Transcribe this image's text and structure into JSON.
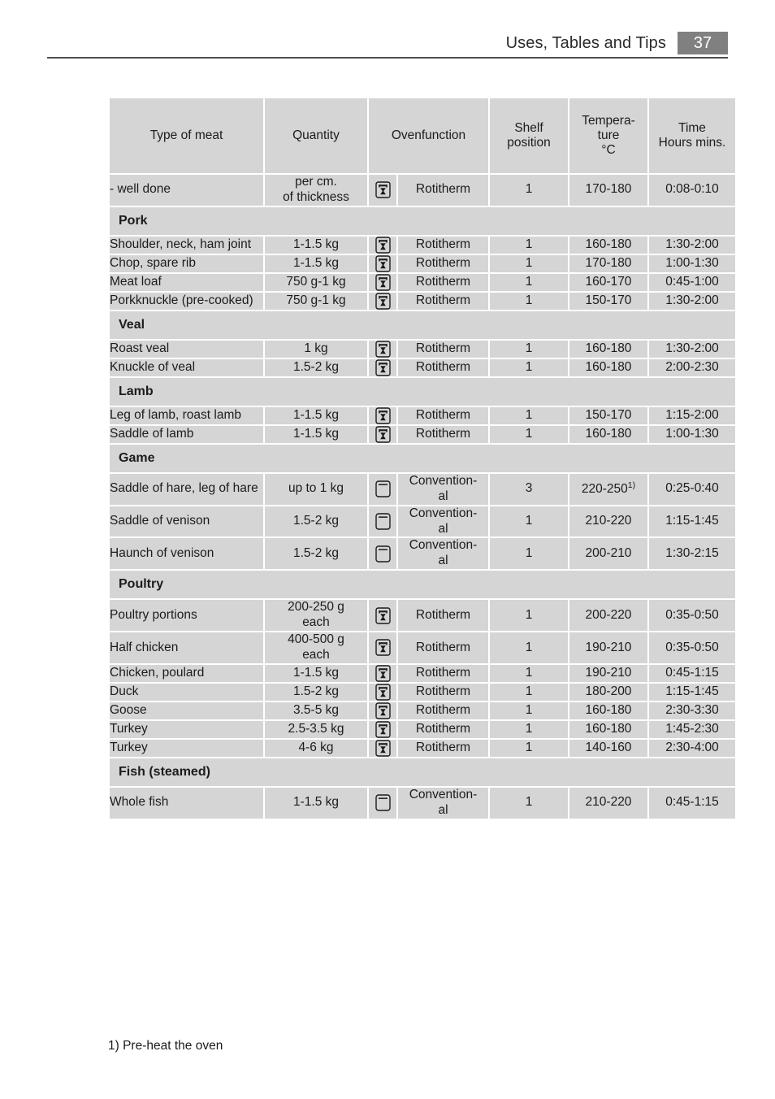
{
  "page_header": {
    "title": "Uses, Tables and Tips",
    "page_number": "37"
  },
  "colors": {
    "header_gray": "#808080",
    "cell_gray": "#d5d5d5",
    "rule": "#4d4d4d",
    "text": "#1c1c1c"
  },
  "table": {
    "columns": [
      {
        "key": "meat",
        "label": "Type of meat"
      },
      {
        "key": "qty",
        "label": "Quantity"
      },
      {
        "key": "fn",
        "label": "Ovenfunction"
      },
      {
        "key": "shelf",
        "label": "Shelf\nposition",
        "line1": "Shelf",
        "line2": "position"
      },
      {
        "key": "temp",
        "label": "Tempera-\nture\n°C",
        "line1": "Tempera-",
        "line2": "ture",
        "line3": "°C"
      },
      {
        "key": "time",
        "label": "Time\nHours mins.",
        "line1": "Time",
        "line2": "Hours mins."
      }
    ],
    "rows": [
      {
        "type": "data",
        "meat": "- well done",
        "qty_line1": "per cm.",
        "qty_line2": "of thickness",
        "icon": "rotitherm-icon",
        "function": "Rotitherm",
        "shelf": "1",
        "temp": "170-180",
        "time": "0:08-0:10"
      },
      {
        "type": "section",
        "label": "Pork"
      },
      {
        "type": "data",
        "meat": "Shoulder, neck, ham joint",
        "qty_line1": "1-1.5 kg",
        "icon": "rotitherm-icon",
        "function": "Rotitherm",
        "shelf": "1",
        "temp": "160-180",
        "time": "1:30-2:00"
      },
      {
        "type": "data",
        "meat": "Chop, spare rib",
        "qty_line1": "1-1.5 kg",
        "icon": "rotitherm-icon",
        "function": "Rotitherm",
        "shelf": "1",
        "temp": "170-180",
        "time": "1:00-1:30"
      },
      {
        "type": "data",
        "meat": "Meat loaf",
        "qty_line1": "750 g-1 kg",
        "icon": "rotitherm-icon",
        "function": "Rotitherm",
        "shelf": "1",
        "temp": "160-170",
        "time": "0:45-1:00"
      },
      {
        "type": "data",
        "meat": "Porkknuckle (pre-cooked)",
        "qty_line1": "750 g-1 kg",
        "icon": "rotitherm-icon",
        "function": "Rotitherm",
        "shelf": "1",
        "temp": "150-170",
        "time": "1:30-2:00"
      },
      {
        "type": "section",
        "label": "Veal"
      },
      {
        "type": "data",
        "meat": "Roast veal",
        "qty_line1": "1 kg",
        "icon": "rotitherm-icon",
        "function": "Rotitherm",
        "shelf": "1",
        "temp": "160-180",
        "time": "1:30-2:00"
      },
      {
        "type": "data",
        "meat": "Knuckle of veal",
        "qty_line1": "1.5-2 kg",
        "icon": "rotitherm-icon",
        "function": "Rotitherm",
        "shelf": "1",
        "temp": "160-180",
        "time": "2:00-2:30"
      },
      {
        "type": "section",
        "label": "Lamb"
      },
      {
        "type": "data",
        "meat": "Leg of lamb, roast lamb",
        "qty_line1": "1-1.5 kg",
        "icon": "rotitherm-icon",
        "function": "Rotitherm",
        "shelf": "1",
        "temp": "150-170",
        "time": "1:15-2:00"
      },
      {
        "type": "data",
        "meat": "Saddle of lamb",
        "qty_line1": "1-1.5 kg",
        "icon": "rotitherm-icon",
        "function": "Rotitherm",
        "shelf": "1",
        "temp": "160-180",
        "time": "1:00-1:30"
      },
      {
        "type": "section",
        "label": "Game"
      },
      {
        "type": "data",
        "meat": "Saddle of hare, leg of hare",
        "qty_line1": "up to 1 kg",
        "icon": "conventional-icon",
        "function": "Convention-al",
        "fn_line1": "Convention-",
        "fn_line2": "al",
        "shelf": "3",
        "temp": "220-250",
        "temp_footnote": "1)",
        "time": "0:25-0:40"
      },
      {
        "type": "data",
        "meat": "Saddle of venison",
        "qty_line1": "1.5-2 kg",
        "icon": "conventional-icon",
        "function": "Convention-al",
        "fn_line1": "Convention-",
        "fn_line2": "al",
        "shelf": "1",
        "temp": "210-220",
        "time": "1:15-1:45"
      },
      {
        "type": "data",
        "meat": "Haunch of venison",
        "qty_line1": "1.5-2 kg",
        "icon": "conventional-icon",
        "function": "Convention-al",
        "fn_line1": "Convention-",
        "fn_line2": "al",
        "shelf": "1",
        "temp": "200-210",
        "time": "1:30-2:15"
      },
      {
        "type": "section",
        "label": "Poultry"
      },
      {
        "type": "data",
        "meat": "Poultry portions",
        "qty_line1": "200-250 g",
        "qty_line2": "each",
        "icon": "rotitherm-icon",
        "function": "Rotitherm",
        "shelf": "1",
        "temp": "200-220",
        "time": "0:35-0:50"
      },
      {
        "type": "data",
        "meat": "Half chicken",
        "qty_line1": "400-500 g",
        "qty_line2": "each",
        "icon": "rotitherm-icon",
        "function": "Rotitherm",
        "shelf": "1",
        "temp": "190-210",
        "time": "0:35-0:50"
      },
      {
        "type": "data",
        "meat": "Chicken, poulard",
        "qty_line1": "1-1.5 kg",
        "icon": "rotitherm-icon",
        "function": "Rotitherm",
        "shelf": "1",
        "temp": "190-210",
        "time": "0:45-1:15"
      },
      {
        "type": "data",
        "meat": "Duck",
        "qty_line1": "1.5-2 kg",
        "icon": "rotitherm-icon",
        "function": "Rotitherm",
        "shelf": "1",
        "temp": "180-200",
        "time": "1:15-1:45"
      },
      {
        "type": "data",
        "meat": "Goose",
        "qty_line1": "3.5-5 kg",
        "icon": "rotitherm-icon",
        "function": "Rotitherm",
        "shelf": "1",
        "temp": "160-180",
        "time": "2:30-3:30"
      },
      {
        "type": "data",
        "meat": "Turkey",
        "qty_line1": "2.5-3.5 kg",
        "icon": "rotitherm-icon",
        "function": "Rotitherm",
        "shelf": "1",
        "temp": "160-180",
        "time": "1:45-2:30"
      },
      {
        "type": "data",
        "meat": "Turkey",
        "qty_line1": "4-6 kg",
        "icon": "rotitherm-icon",
        "function": "Rotitherm",
        "shelf": "1",
        "temp": "140-160",
        "time": "2:30-4:00"
      },
      {
        "type": "section",
        "label": "Fish (steamed)"
      },
      {
        "type": "data",
        "meat": "Whole fish",
        "qty_line1": "1-1.5 kg",
        "icon": "conventional-icon",
        "function": "Convention-al",
        "fn_line1": "Convention-",
        "fn_line2": "al",
        "shelf": "1",
        "temp": "210-220",
        "time": "0:45-1:15"
      }
    ]
  },
  "footnote": "1) Pre-heat the oven"
}
